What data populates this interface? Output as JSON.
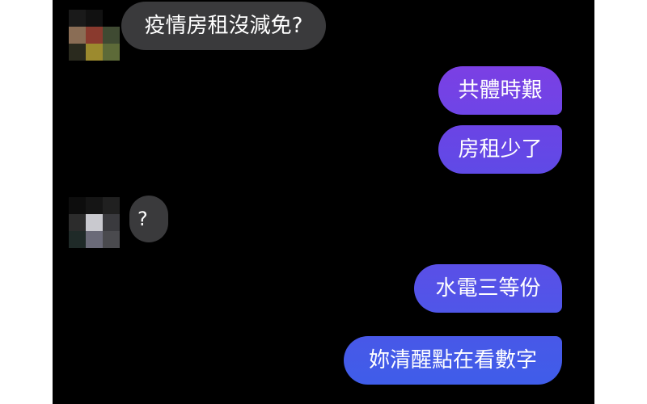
{
  "conversation": {
    "messages": [
      {
        "sender": "other",
        "text": "疫情房租沒減免?"
      },
      {
        "sender": "me",
        "text": "共體時艱"
      },
      {
        "sender": "me",
        "text": "房租少了"
      },
      {
        "sender": "other",
        "text": "?"
      },
      {
        "sender": "me",
        "text": "水電三等份"
      },
      {
        "sender": "me",
        "text": "妳清醒點在看數字"
      }
    ]
  },
  "colors": {
    "background": "#000000",
    "incoming_bubble": "#3a3a3c",
    "outgoing_gradient_top": "#7b3fe4",
    "outgoing_gradient_bottom": "#3d5ee8"
  }
}
